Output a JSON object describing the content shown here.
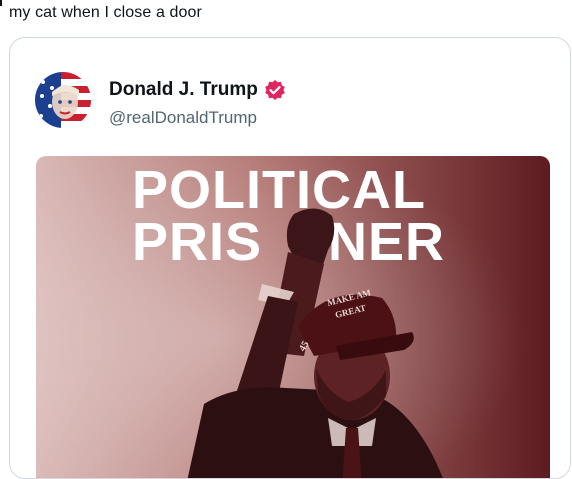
{
  "caption": {
    "text": "my cat when I close a door"
  },
  "post": {
    "display_name": "Donald J. Trump",
    "handle": "@realDonaldTrump",
    "verified": true,
    "verified_color": "#e0245e"
  },
  "media": {
    "headline_line1": "POLITICAL",
    "headline_line2": "PRIS",
    "headline_line2b": "NER",
    "hat_text_line1": "MAKE AM",
    "hat_text_line2": "GREAT",
    "hat_number": "45",
    "tint_color": "#8a3a3c"
  }
}
